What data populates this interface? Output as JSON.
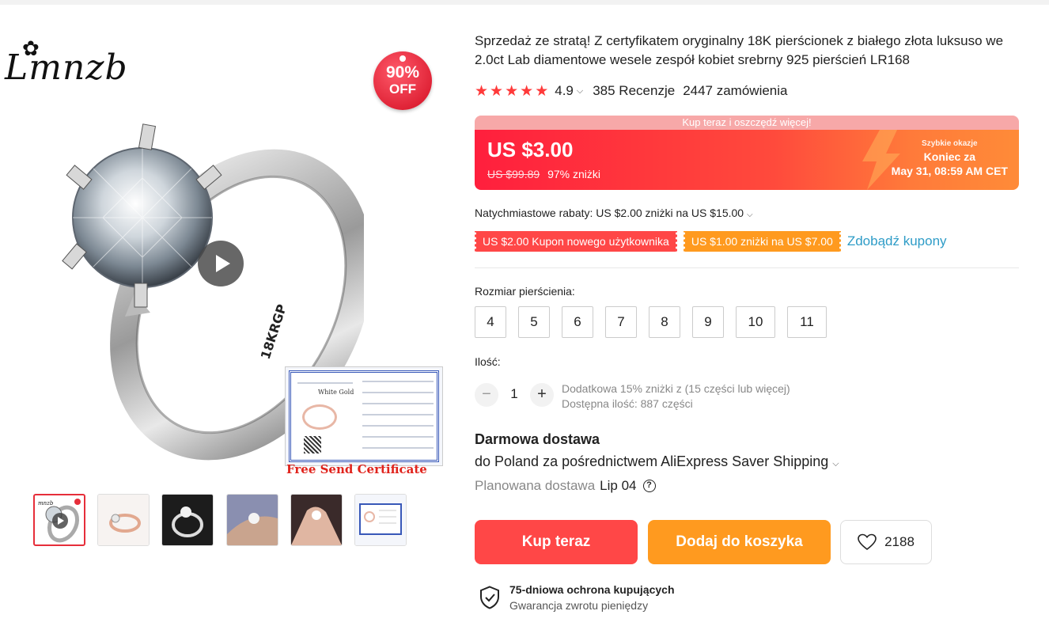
{
  "product": {
    "title": "Sprzedaż ze stratą! Z certyfikatem oryginalny 18K pierścionek z białego złota luksuso we 2.0ct Lab diamentowe wesele zespół kobiet srebrny 925 pierścień LR168",
    "rating": "4.9",
    "rating_stars": 5,
    "reviews": "385 Recenzje",
    "orders": "2447 zamówienia"
  },
  "gallery": {
    "brand": "mnzb",
    "brand_prefix": "L",
    "badge_percent": "90%",
    "badge_off": "OFF",
    "ring_engraving": "18KRGP",
    "certificate_caption": "Free Send Certificate",
    "certificate_text": "White Gold",
    "thumbnails": 6,
    "active_thumbnail": 0
  },
  "promo": {
    "banner": "Kup teraz i oszczędź więcej!",
    "price": "US $3.00",
    "old_price": "US $99.89",
    "discount": "97% zniżki",
    "flash_title": "Szybkie okazje",
    "flash_label": "Koniec za",
    "flash_time": "May 31, 08:59 AM CET"
  },
  "discounts": {
    "instant": "Natychmiastowe rabaty: US $2.00 zniżki na US $15.00",
    "coupon_new_user": "US $2.00 Kupon nowego użytkownika",
    "coupon_store": "US $1.00 zniżki na US $7.00",
    "get_coupons": "Zdobądź kupony"
  },
  "size": {
    "label": "Rozmiar pierścienia:",
    "options": [
      "4",
      "5",
      "6",
      "7",
      "8",
      "9",
      "10",
      "11"
    ]
  },
  "quantity": {
    "label": "Ilość:",
    "minus": "−",
    "plus": "+",
    "value": "1",
    "note_discount": "Dodatkowa 15% zniżki z (15 części lub więcej)",
    "note_available": "Dostępna ilość: 887 części"
  },
  "shipping": {
    "title": "Darmowa dostawa",
    "via": "do Poland za pośrednictwem AliExpress Saver Shipping",
    "planned_label": "Planowana dostawa",
    "planned_date": "Lip 04",
    "help": "?"
  },
  "actions": {
    "buy_now": "Kup teraz",
    "add_to_cart": "Dodaj do koszyka",
    "wishlist_count": "2188"
  },
  "protection": {
    "title": "75-dniowa ochrona kupujących",
    "subtitle": "Gwarancja zwrotu pieniędzy"
  },
  "colors": {
    "accent_red": "#ff4747",
    "accent_orange": "#ff9a1f",
    "star": "#ff3a3a",
    "link": "#2e9cc7"
  }
}
